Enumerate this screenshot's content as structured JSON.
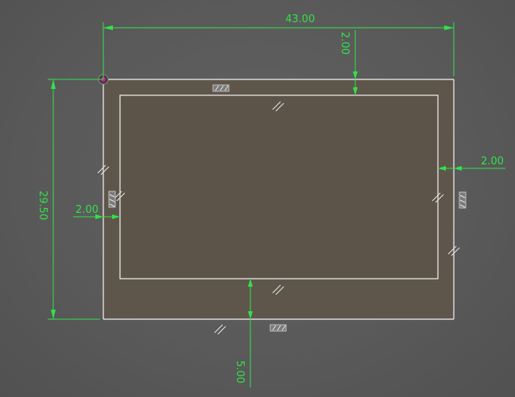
{
  "sketch": {
    "overall_width": "43.00",
    "overall_height": "29.50",
    "top_offset": "2.00",
    "right_offset": "2.00",
    "left_offset": "2.00",
    "bottom_offset": "5.00"
  },
  "colors": {
    "dimension": "#31e24a",
    "profile_fill": "#5f564b",
    "edge": "#f2f2f2",
    "origin_point": "#c0208c"
  }
}
